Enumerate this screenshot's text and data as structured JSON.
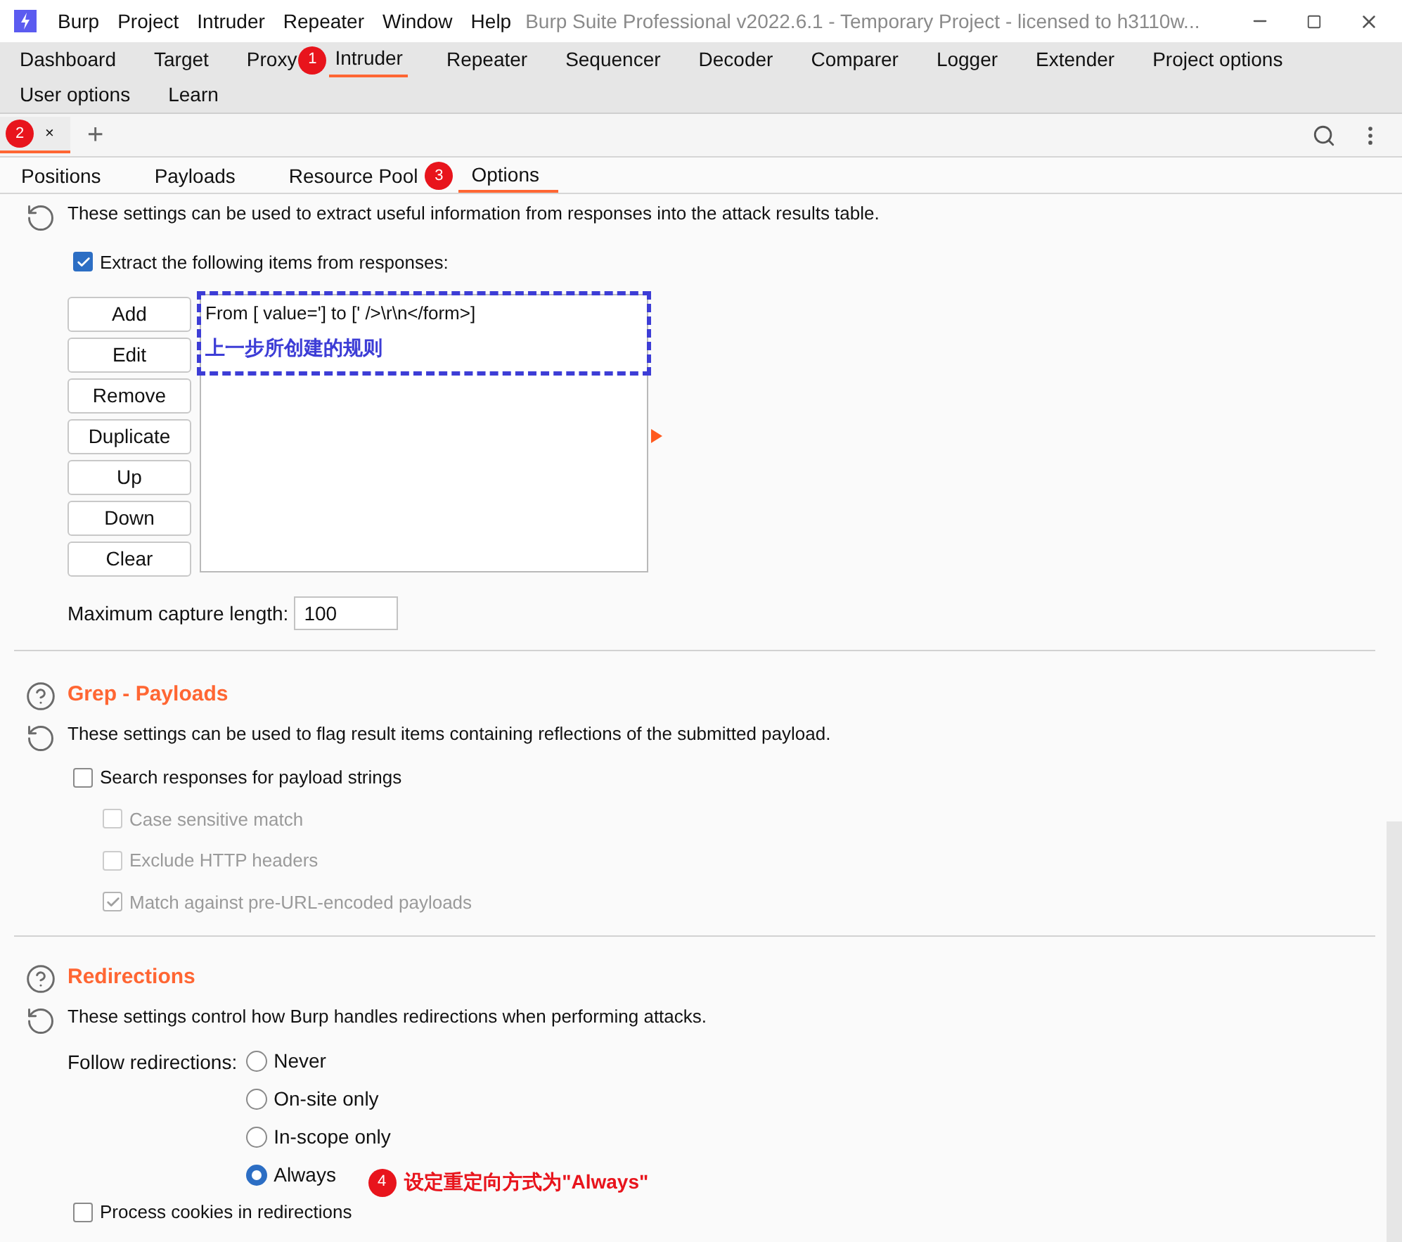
{
  "window": {
    "title": "Burp Suite Professional v2022.6.1 - Temporary Project - licensed to h3110w..."
  },
  "menu": [
    "Burp",
    "Project",
    "Intruder",
    "Repeater",
    "Window",
    "Help"
  ],
  "main_tabs": [
    {
      "label": "Dashboard",
      "selected": false
    },
    {
      "label": "Target",
      "selected": false
    },
    {
      "label": "Proxy",
      "selected": false
    },
    {
      "label": "Intruder",
      "selected": true,
      "annotation": "1"
    },
    {
      "label": "Repeater",
      "selected": false
    },
    {
      "label": "Sequencer",
      "selected": false
    },
    {
      "label": "Decoder",
      "selected": false
    },
    {
      "label": "Comparer",
      "selected": false
    },
    {
      "label": "Logger",
      "selected": false
    },
    {
      "label": "Extender",
      "selected": false
    },
    {
      "label": "Project options",
      "selected": false
    },
    {
      "label": "User options",
      "selected": false
    },
    {
      "label": "Learn",
      "selected": false
    }
  ],
  "attack_tabs": [
    {
      "label": "×",
      "selected": true,
      "annotation": "2"
    }
  ],
  "new_tab": "+",
  "sub_tabs": [
    {
      "label": "Positions",
      "selected": false
    },
    {
      "label": "Payloads",
      "selected": false
    },
    {
      "label": "Resource Pool",
      "selected": false
    },
    {
      "label": "Options",
      "selected": true,
      "annotation": "3"
    }
  ],
  "extract": {
    "description": "These settings can be used to extract useful information from responses into the attack results table.",
    "checkbox": {
      "label": "Extract the following items from responses:",
      "checked": true
    },
    "buttons": [
      "Add",
      "Edit",
      "Remove",
      "Duplicate",
      "Up",
      "Down",
      "Clear"
    ],
    "items": [
      "From [ value='] to [' />\\r\\n</form>]"
    ],
    "callout": "上一步所创建的规则",
    "max_length": {
      "label": "Maximum capture length:",
      "value": "100"
    }
  },
  "grep_payloads": {
    "title": "Grep - Payloads",
    "description": "These settings can be used to flag result items containing reflections of the submitted payload.",
    "options": [
      {
        "label": "Search responses for payload strings",
        "checked": false,
        "disabled": false,
        "children": [
          {
            "label": "Case sensitive match",
            "checked": false,
            "disabled": true
          },
          {
            "label": "Exclude HTTP headers",
            "checked": false,
            "disabled": true
          },
          {
            "label": "Match against pre-URL-encoded payloads",
            "checked": true,
            "disabled": true
          }
        ]
      }
    ]
  },
  "redirections": {
    "title": "Redirections",
    "description": "These settings control how Burp handles redirections when performing attacks.",
    "follow_label": "Follow redirections:",
    "options": [
      {
        "label": "Never",
        "selected": false
      },
      {
        "label": "On-site only",
        "selected": false
      },
      {
        "label": "In-scope only",
        "selected": false
      },
      {
        "label": "Always",
        "selected": true
      }
    ],
    "annotation": {
      "number": "4",
      "text": "设定重定向方式为\"Always\""
    },
    "process_cookies": {
      "label": "Process cookies in redirections",
      "checked": false
    }
  }
}
